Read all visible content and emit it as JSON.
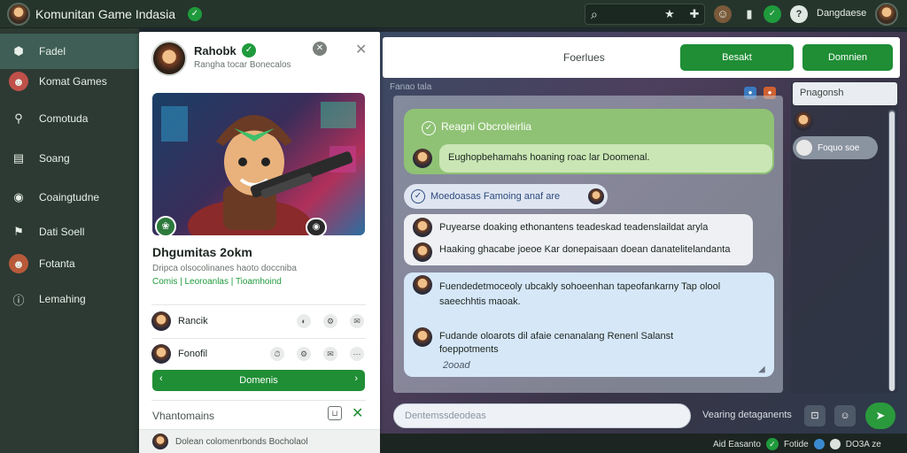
{
  "app": {
    "title": "Komunitan Game Indasia",
    "username": "Dangdaese"
  },
  "sidebar": {
    "items": [
      {
        "label": "Fadel",
        "icon": "cube-icon"
      },
      {
        "label": "Komat Games",
        "icon": "avatar-icon"
      },
      {
        "label": "Comotuda",
        "icon": "link-icon"
      },
      {
        "label": "Soang",
        "icon": "card-icon"
      },
      {
        "label": "Coaingtudne",
        "icon": "chat-icon"
      },
      {
        "label": "Dati Soell",
        "icon": "flag-icon"
      },
      {
        "label": "Fotanta",
        "icon": "avatar-icon"
      },
      {
        "label": "Lemahing",
        "icon": "info-icon"
      }
    ]
  },
  "profile": {
    "name": "Rahobk",
    "subtitle": "Rangha tocar Bonecalos",
    "title": "Dhgumitas 2okm",
    "description": "Dripca olsocolinanes haoto doccniba",
    "tags": "Comis | Leoroanlas | Tioamhoind",
    "members": [
      {
        "name": "Rancik"
      },
      {
        "name": "Fonofil"
      }
    ],
    "action_label": "Domenis",
    "footer_label": "Vhantomains",
    "bottom_text": "Dolean colomenrbonds Bocholaol"
  },
  "header": {
    "title": "Foerlues",
    "button1": "Besakt",
    "button2": "Domnien"
  },
  "crumb": "Fanao tala",
  "pinned": {
    "title": "Reagni Obcroleirlia",
    "message": "Eughopbehamahs hoaning roac lar Doomenal."
  },
  "topic": "Moedoasas Famoing anaf are",
  "messages_grey": [
    "Puyearse doaking ethonantens teadeskad teadenslaildat aryla",
    "Haaking ghacabe joeoe Kar donepaisaan doean danatelitelandanta"
  ],
  "messages_blue": [
    "Fuendedetmoceoly ubcakly sohoeenhan tapeofankarny Tap olool",
    "saeechhtis maoak.",
    "Fudande oloarots dil afaie cenanalang Renenl Salanst",
    "foeppotments",
    "2ooad"
  ],
  "members_panel": {
    "header": "Pnagonsh",
    "chip": "Foquo soe"
  },
  "composer": {
    "placeholder": "Dentemssdeodeas",
    "hint": "Vearing detaganents"
  },
  "status": {
    "text1": "Aid Easanto",
    "text2": "Fotide",
    "text3": "DO3A ze"
  },
  "colors": {
    "accent_green": "#1f8e35",
    "sidebar_bg": "#2c3a33",
    "topbar_bg": "#25352c"
  }
}
